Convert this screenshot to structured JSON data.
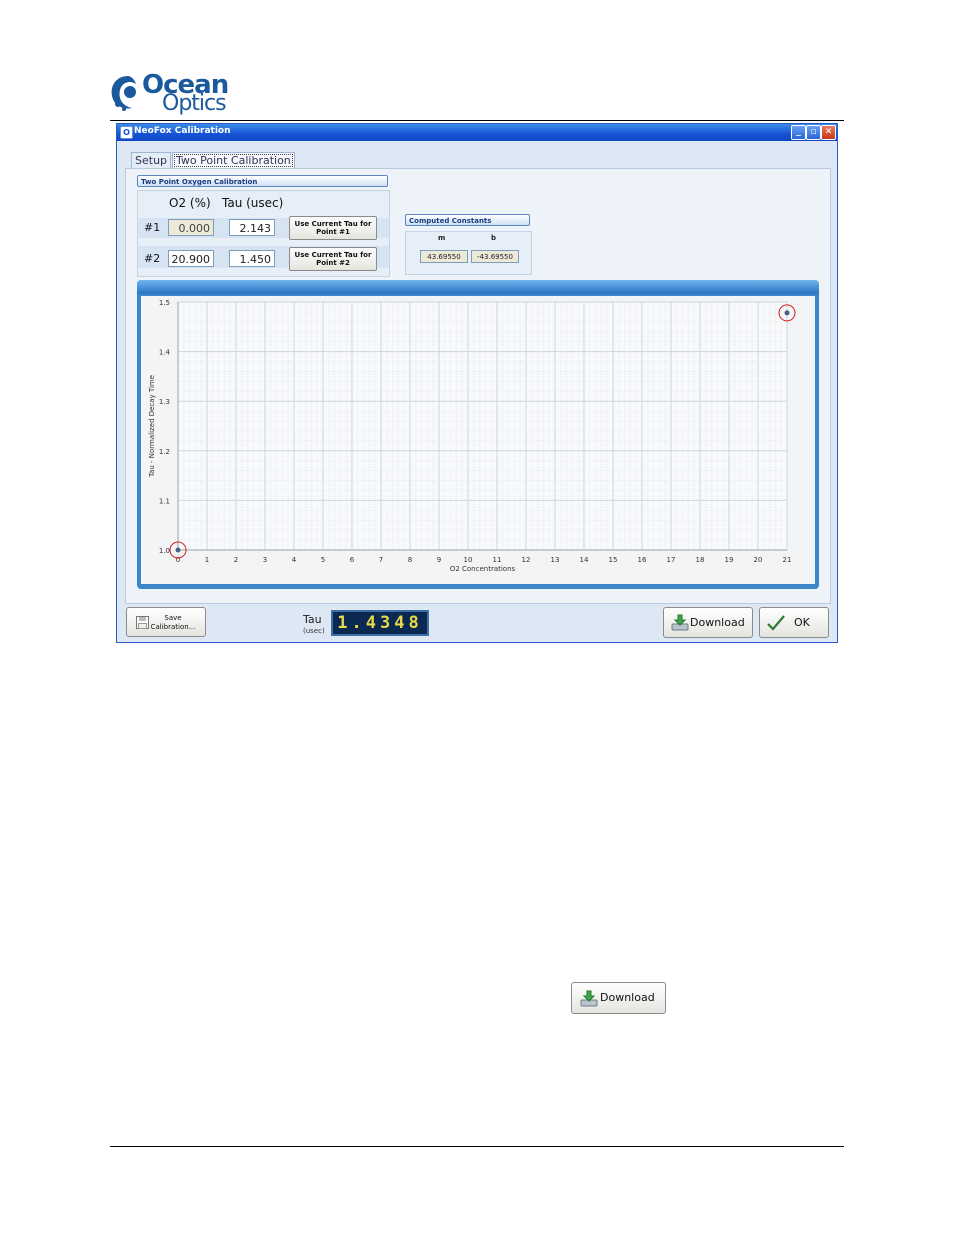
{
  "brand": {
    "line1": "Ocean",
    "line2": "Optics"
  },
  "window": {
    "title": "NeoFox Calibration",
    "controls": {
      "minimize": "_",
      "maximize": "▫",
      "close": "✕"
    }
  },
  "tabs": [
    {
      "label": "Setup"
    },
    {
      "label": "Two Point Calibration"
    }
  ],
  "calibration": {
    "section_title": "Two Point Oxygen Calibration",
    "col_o2": "O2 (%)",
    "col_tau": "Tau (usec)",
    "rows": [
      {
        "label": "#1",
        "o2": "0.000",
        "tau": "2.143",
        "button": "Use Current Tau for Point #1"
      },
      {
        "label": "#2",
        "o2": "20.900",
        "tau": "1.450",
        "button": "Use Current Tau for Point #2"
      }
    ]
  },
  "computed_constants": {
    "title": "Computed Constants",
    "m_label": "m",
    "b_label": "b",
    "m_value": "43.69550",
    "b_value": "-43.69550"
  },
  "chart_data": {
    "type": "scatter",
    "title": "",
    "xlabel": "O2 Concentrations",
    "ylabel": "Tau - Normalized Decay Time",
    "xlim": [
      0,
      21
    ],
    "ylim": [
      1.0,
      1.5
    ],
    "x_ticks": [
      "0",
      "1",
      "2",
      "3",
      "4",
      "5",
      "6",
      "7",
      "8",
      "9",
      "10",
      "11",
      "12",
      "13",
      "14",
      "15",
      "16",
      "17",
      "18",
      "19",
      "20",
      "21"
    ],
    "y_ticks": [
      "1.0",
      "1.1",
      "1.2",
      "1.3",
      "1.4",
      "1.5"
    ],
    "grid": true,
    "series": [
      {
        "points": [
          {
            "x": 0,
            "y": 1.0
          },
          {
            "x": 21,
            "y": 1.478
          }
        ]
      }
    ],
    "highlight_color": "#d42020",
    "point_color": "#4a5f8a"
  },
  "footer": {
    "save_button": "Save Calibration...",
    "tau_label": "Tau",
    "tau_unit": "(usec)",
    "tau_readout": "1.4348",
    "download_button": "Download",
    "ok_button": "OK"
  },
  "standalone": {
    "download_button": "Download"
  },
  "icons": {
    "save": "floppy-icon",
    "download": "download-icon",
    "ok": "checkmark-icon",
    "logo": "ocean-swirl-icon"
  }
}
